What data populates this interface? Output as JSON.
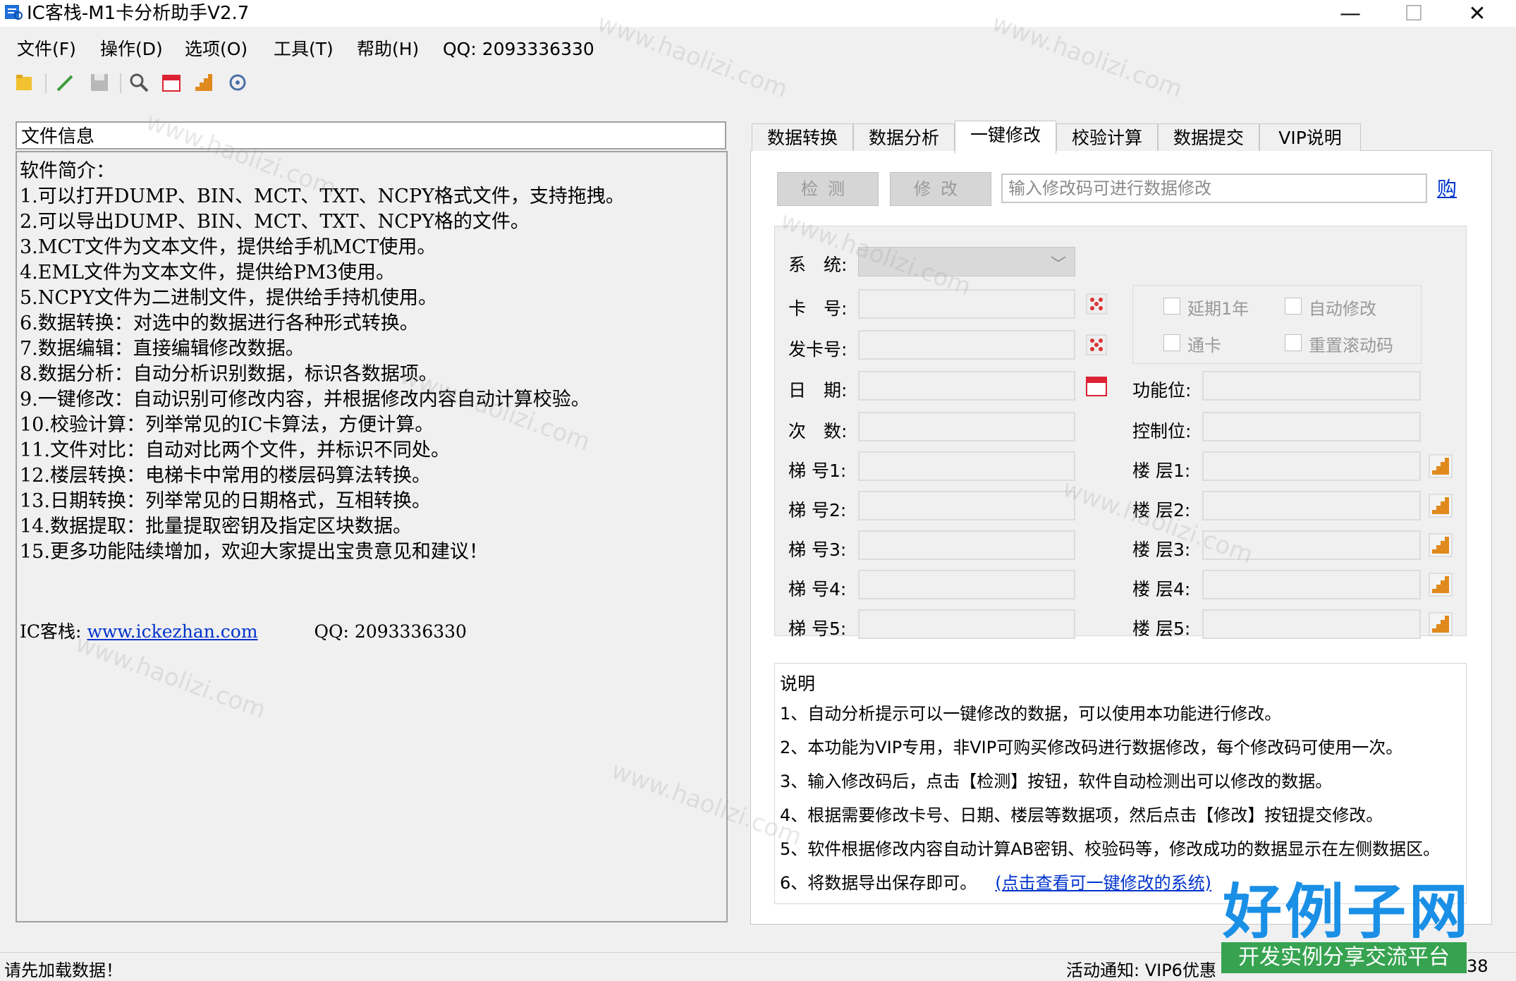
{
  "window": {
    "title": "IC客栈-M1卡分析助手V2.7",
    "controls": {
      "minimize": "—",
      "maximize": "☐",
      "close": "✕"
    }
  },
  "menu": [
    "文件(F)",
    "操作(D)",
    "选项(O)",
    "工具(T)",
    "帮助(H)",
    "QQ: 2093336330"
  ],
  "toolbar_icons": [
    "open-folder-icon",
    "pencil-icon",
    "save-disk-icon",
    "search-icon",
    "calendar-icon",
    "stairs-icon",
    "settings-icon"
  ],
  "left_panel": {
    "header": "文件信息",
    "intro_lines": [
      "软件简介：",
      "1.可以打开DUMP、BIN、MCT、TXT、NCPY格式文件，支持拖拽。",
      "2.可以导出DUMP、BIN、MCT、TXT、NCPY格的文件。",
      "3.MCT文件为文本文件，提供给手机MCT使用。",
      "4.EML文件为文本文件，提供给PM3使用。",
      "5.NCPY文件为二进制文件，提供给手持机使用。",
      "6.数据转换：对选中的数据进行各种形式转换。",
      "7.数据编辑：直接编辑修改数据。",
      "8.数据分析：自动分析识别数据，标识各数据项。",
      "9.一键修改：自动识别可修改内容，并根据修改内容自动计算校验。",
      "10.校验计算：列举常见的IC卡算法，方便计算。",
      "11.文件对比：自动对比两个文件，并标识不同处。",
      "12.楼层转换：电梯卡中常用的楼层码算法转换。",
      "13.日期转换：列举常见的日期格式，互相转换。",
      "14.数据提取：批量提取密钥及指定区块数据。",
      "15.更多功能陆续增加，欢迎大家提出宝贵意见和建议！"
    ],
    "site_label": "IC客栈:",
    "site_link": "www.ickezhan.com",
    "qq": "QQ: 2093336330"
  },
  "tabs": [
    {
      "label": "数据转换",
      "active": false
    },
    {
      "label": "数据分析",
      "active": false
    },
    {
      "label": "一键修改",
      "active": true
    },
    {
      "label": "校验计算",
      "active": false
    },
    {
      "label": "数据提交",
      "active": false
    },
    {
      "label": "VIP说明",
      "active": false
    }
  ],
  "edit_tab": {
    "detect_button": "检测",
    "modify_button": "修改",
    "code_placeholder": "输入修改码可进行数据修改",
    "buy_link": "购",
    "labels": {
      "system": "系　统:",
      "card_no": "卡　号:",
      "issuer_no": "发卡号:",
      "date": "日　期:",
      "count": "次　数:",
      "elevator1": "梯 号1:",
      "elevator2": "梯 号2:",
      "elevator3": "梯 号3:",
      "elevator4": "梯 号4:",
      "elevator5": "梯 号5:",
      "func_bits": "功能位:",
      "ctrl_bits": "控制位:",
      "floor1": "楼 层1:",
      "floor2": "楼 层2:",
      "floor3": "楼 层3:",
      "floor4": "楼 层4:",
      "floor5": "楼 层5:"
    },
    "options": {
      "extend_year": "延期1年",
      "auto_modify": "自动修改",
      "universal_card": "通卡",
      "reset_rolling": "重置滚动码"
    },
    "notes_title": "说明",
    "notes": [
      "1、自动分析提示可以一键修改的数据，可以使用本功能进行修改。",
      "2、本功能为VIP专用，非VIP可购买修改码进行数据修改，每个修改码可使用一次。",
      "3、输入修改码后，点击【检测】按钮，软件自动检测出可以修改的数据。",
      "4、根据需要修改卡号、日期、楼层等数据项，然后点击【修改】按钮提交修改。",
      "5、软件根据修改内容自动计算AB密钥、校验码等，修改成功的数据显示在左侧数据区。",
      "6、将数据导出保存即可。"
    ],
    "notes_link": "(点击查看可一键修改的系统)"
  },
  "status": {
    "left": "请先加载数据！",
    "notice": "活动通知: VIP6优惠",
    "right_num": "38"
  },
  "watermark": {
    "text": "www.haolizi.com",
    "logo": "好例子网",
    "logo_sub": "开发实例分享交流平台"
  },
  "colors": {
    "link": "#0033cc",
    "logo_blue": "#1a8fe6",
    "logo_green": "#37a350",
    "disabled_btn": "#d6d6d6"
  }
}
